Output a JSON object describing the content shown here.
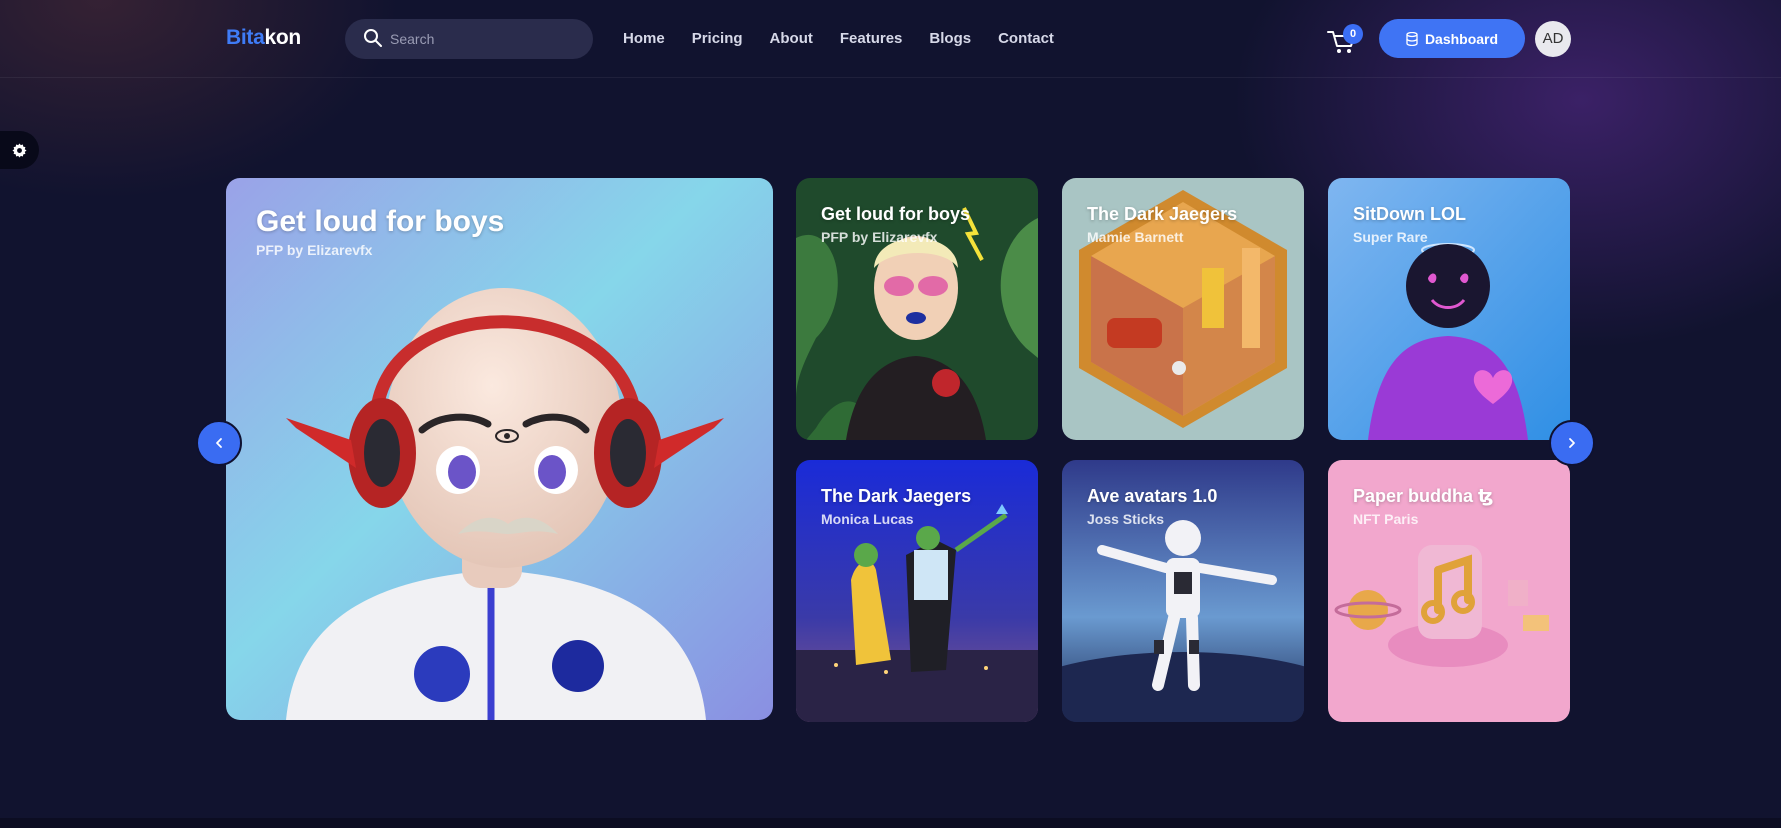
{
  "brand": {
    "part1": "Bita",
    "part2": "kon"
  },
  "search": {
    "placeholder": "Search"
  },
  "nav": [
    "Home",
    "Pricing",
    "About",
    "Features",
    "Blogs",
    "Contact"
  ],
  "cart": {
    "count": "0",
    "icon": "cart-icon"
  },
  "dashboard_button": {
    "label": "Dashboard",
    "icon": "database-icon"
  },
  "avatar": {
    "initials": "AD"
  },
  "settings": {
    "icon": "gear-icon"
  },
  "featured": {
    "title": "Get loud for boys",
    "subtitle": "PFP by Elizarevfx"
  },
  "cards": [
    {
      "title": "Get loud for boys",
      "subtitle": "PFP by Elizarevfx"
    },
    {
      "title": "The Dark Jaegers",
      "subtitle": "Mamie Barnett"
    },
    {
      "title": "SitDown LOL",
      "subtitle": "Super Rare"
    },
    {
      "title": "The Dark Jaegers",
      "subtitle": "Monica Lucas"
    },
    {
      "title": "Ave avatars 1.0",
      "subtitle": "Joss Sticks"
    },
    {
      "title": "Paper buddha ꜩ",
      "subtitle": "NFT Paris"
    }
  ],
  "carousel": {
    "prev_icon": "chevron-left-icon",
    "next_icon": "chevron-right-icon"
  },
  "colors": {
    "background": "#11132f",
    "accent": "#3f74f4"
  }
}
